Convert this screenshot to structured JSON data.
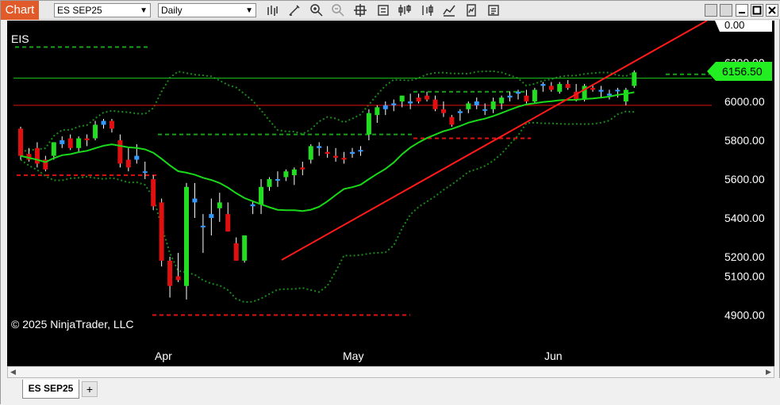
{
  "app": {
    "tab_label": "Chart"
  },
  "toolbar": {
    "instrument_value": "ES SEP25",
    "interval_value": "Daily",
    "tools": [
      "bar-chart-style-icon",
      "draw-pencil-icon",
      "zoom-in-icon",
      "zoom-out-icon",
      "crosshair-icon",
      "data-box-icon",
      "indicators-icon",
      "strategies-icon",
      "chart-trader-icon",
      "templates-icon",
      "properties-icon"
    ]
  },
  "chart": {
    "symbol_label": "EIS",
    "copyright": "© 2025 NinjaTrader, LLC",
    "current_price": "6156.50",
    "top_partial_label": "0.00",
    "y_labels": [
      "6200.00",
      "6000.00",
      "5800.00",
      "5600.00",
      "5400.00",
      "5200.00",
      "5100.00",
      "4900.00"
    ],
    "x_labels": [
      "Apr",
      "May",
      "Jun"
    ],
    "colors": {
      "up": "#22dd22",
      "down": "#e01010",
      "doji_up": "#3399ff",
      "trend": "#ff1a1a",
      "ma": "#19d919",
      "band": "#1a8a1a",
      "price_tag": "#22ee22"
    }
  },
  "chart_data": {
    "type": "candlestick",
    "title": "EIS",
    "instrument": "ES SEP25",
    "interval": "Daily",
    "yticks": [
      6200,
      6000,
      5800,
      5600,
      5400,
      5200,
      5100,
      4900
    ],
    "xticks": [
      "Apr",
      "May",
      "Jun"
    ],
    "last_price": 6156.5,
    "ohlc_approx": [
      {
        "o": 5860,
        "h": 5870,
        "l": 5700,
        "c": 5720
      },
      {
        "o": 5730,
        "h": 5760,
        "l": 5690,
        "c": 5700
      },
      {
        "o": 5760,
        "h": 5790,
        "l": 5660,
        "c": 5680
      },
      {
        "o": 5700,
        "h": 5720,
        "l": 5640,
        "c": 5650
      },
      {
        "o": 5720,
        "h": 5790,
        "l": 5700,
        "c": 5790
      },
      {
        "o": 5780,
        "h": 5820,
        "l": 5760,
        "c": 5800
      },
      {
        "o": 5810,
        "h": 5830,
        "l": 5750,
        "c": 5760
      },
      {
        "o": 5760,
        "h": 5820,
        "l": 5740,
        "c": 5810
      },
      {
        "o": 5810,
        "h": 5830,
        "l": 5770,
        "c": 5800
      },
      {
        "o": 5810,
        "h": 5900,
        "l": 5800,
        "c": 5880
      },
      {
        "o": 5880,
        "h": 5910,
        "l": 5860,
        "c": 5900
      },
      {
        "o": 5900,
        "h": 5910,
        "l": 5840,
        "c": 5860
      },
      {
        "o": 5800,
        "h": 5830,
        "l": 5660,
        "c": 5680
      },
      {
        "o": 5700,
        "h": 5760,
        "l": 5640,
        "c": 5660
      },
      {
        "o": 5700,
        "h": 5780,
        "l": 5680,
        "c": 5720
      },
      {
        "o": 5640,
        "h": 5690,
        "l": 5600,
        "c": 5640
      },
      {
        "o": 5600,
        "h": 5620,
        "l": 5440,
        "c": 5460
      },
      {
        "o": 5480,
        "h": 5500,
        "l": 5150,
        "c": 5180
      },
      {
        "o": 5180,
        "h": 5200,
        "l": 4990,
        "c": 5050
      },
      {
        "o": 5100,
        "h": 5220,
        "l": 5070,
        "c": 5080
      },
      {
        "o": 5050,
        "h": 5580,
        "l": 4980,
        "c": 5560
      },
      {
        "o": 5480,
        "h": 5580,
        "l": 5400,
        "c": 5500
      },
      {
        "o": 5360,
        "h": 5420,
        "l": 5220,
        "c": 5360
      },
      {
        "o": 5400,
        "h": 5500,
        "l": 5310,
        "c": 5420
      },
      {
        "o": 5450,
        "h": 5530,
        "l": 5380,
        "c": 5480
      },
      {
        "o": 5420,
        "h": 5480,
        "l": 5330,
        "c": 5330
      },
      {
        "o": 5270,
        "h": 5300,
        "l": 5180,
        "c": 5180
      },
      {
        "o": 5180,
        "h": 5300,
        "l": 5170,
        "c": 5310
      },
      {
        "o": 5460,
        "h": 5490,
        "l": 5420,
        "c": 5470
      },
      {
        "o": 5470,
        "h": 5600,
        "l": 5420,
        "c": 5560
      },
      {
        "o": 5560,
        "h": 5610,
        "l": 5540,
        "c": 5600
      },
      {
        "o": 5600,
        "h": 5640,
        "l": 5560,
        "c": 5600
      },
      {
        "o": 5610,
        "h": 5650,
        "l": 5590,
        "c": 5640
      },
      {
        "o": 5620,
        "h": 5660,
        "l": 5570,
        "c": 5650
      },
      {
        "o": 5660,
        "h": 5690,
        "l": 5620,
        "c": 5650
      },
      {
        "o": 5700,
        "h": 5780,
        "l": 5680,
        "c": 5770
      },
      {
        "o": 5760,
        "h": 5790,
        "l": 5720,
        "c": 5770
      },
      {
        "o": 5740,
        "h": 5770,
        "l": 5710,
        "c": 5730
      },
      {
        "o": 5720,
        "h": 5760,
        "l": 5690,
        "c": 5710
      },
      {
        "o": 5710,
        "h": 5740,
        "l": 5680,
        "c": 5700
      },
      {
        "o": 5730,
        "h": 5760,
        "l": 5710,
        "c": 5740
      },
      {
        "o": 5750,
        "h": 5770,
        "l": 5720,
        "c": 5750
      },
      {
        "o": 5830,
        "h": 5960,
        "l": 5800,
        "c": 5940
      },
      {
        "o": 5930,
        "h": 5980,
        "l": 5890,
        "c": 5970
      },
      {
        "o": 5960,
        "h": 6000,
        "l": 5930,
        "c": 5980
      },
      {
        "o": 5980,
        "h": 6010,
        "l": 5950,
        "c": 5990
      },
      {
        "o": 6000,
        "h": 6030,
        "l": 5970,
        "c": 6030
      },
      {
        "o": 5990,
        "h": 6040,
        "l": 5960,
        "c": 6000
      },
      {
        "o": 6020,
        "h": 6040,
        "l": 5990,
        "c": 6000
      },
      {
        "o": 6030,
        "h": 6050,
        "l": 6000,
        "c": 6010
      },
      {
        "o": 6010,
        "h": 6030,
        "l": 5950,
        "c": 5960
      },
      {
        "o": 5960,
        "h": 6000,
        "l": 5920,
        "c": 5940
      },
      {
        "o": 5920,
        "h": 5930,
        "l": 5870,
        "c": 5880
      },
      {
        "o": 5940,
        "h": 5960,
        "l": 5900,
        "c": 5950
      },
      {
        "o": 5960,
        "h": 6000,
        "l": 5940,
        "c": 5990
      },
      {
        "o": 5980,
        "h": 6020,
        "l": 5960,
        "c": 6000
      },
      {
        "o": 5960,
        "h": 5990,
        "l": 5930,
        "c": 5960
      },
      {
        "o": 5960,
        "h": 6020,
        "l": 5940,
        "c": 6000
      },
      {
        "o": 5990,
        "h": 6030,
        "l": 5960,
        "c": 6020
      },
      {
        "o": 6020,
        "h": 6050,
        "l": 6000,
        "c": 6030
      },
      {
        "o": 6040,
        "h": 6060,
        "l": 6010,
        "c": 6050
      },
      {
        "o": 6030,
        "h": 6060,
        "l": 5990,
        "c": 6000
      },
      {
        "o": 6000,
        "h": 6070,
        "l": 5990,
        "c": 6060
      },
      {
        "o": 6080,
        "h": 6100,
        "l": 6050,
        "c": 6090
      },
      {
        "o": 6080,
        "h": 6100,
        "l": 6050,
        "c": 6060
      },
      {
        "o": 6050,
        "h": 6100,
        "l": 6040,
        "c": 6090
      },
      {
        "o": 6090,
        "h": 6110,
        "l": 6060,
        "c": 6070
      },
      {
        "o": 6050,
        "h": 6090,
        "l": 6000,
        "c": 6010
      },
      {
        "o": 6010,
        "h": 6090,
        "l": 6000,
        "c": 6080
      },
      {
        "o": 6070,
        "h": 6090,
        "l": 6050,
        "c": 6060
      },
      {
        "o": 6050,
        "h": 6080,
        "l": 6020,
        "c": 6060
      },
      {
        "o": 6030,
        "h": 6060,
        "l": 6010,
        "c": 6040
      },
      {
        "o": 6060,
        "h": 6070,
        "l": 6020,
        "c": 6060
      },
      {
        "o": 6000,
        "h": 6070,
        "l": 5980,
        "c": 6060
      },
      {
        "o": 6080,
        "h": 6160,
        "l": 6070,
        "c": 6150
      }
    ],
    "horizontal_lines": [
      6120,
      5980
    ],
    "dashed_levels_approx": [
      6280,
      5830,
      5620,
      4900,
      6050,
      5810,
      6140
    ]
  }
}
